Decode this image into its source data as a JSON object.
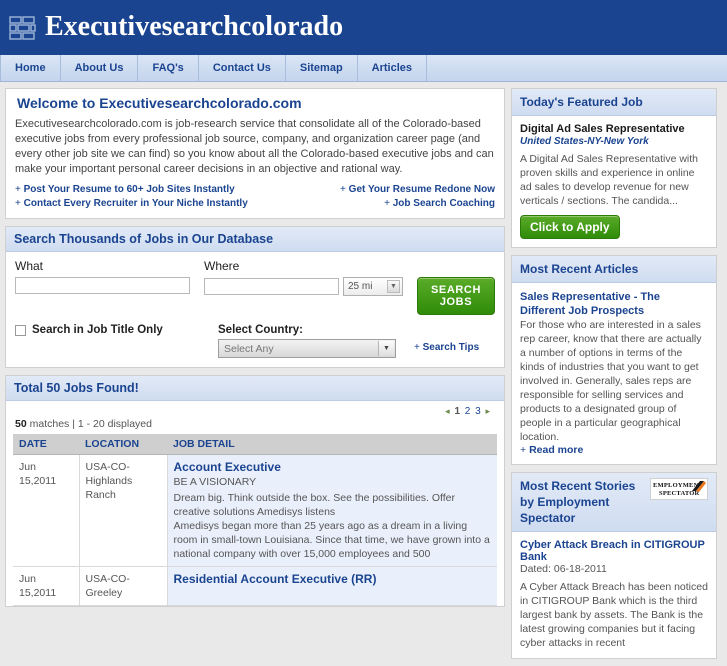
{
  "header": {
    "site_title": "Executivesearchcolorado",
    "logo_icon": "brick-blocks-icon",
    "brand_color": "#1b4490"
  },
  "nav": {
    "items": [
      {
        "label": "Home"
      },
      {
        "label": "About Us"
      },
      {
        "label": "FAQ's"
      },
      {
        "label": "Contact Us"
      },
      {
        "label": "Sitemap"
      },
      {
        "label": "Articles"
      }
    ]
  },
  "welcome": {
    "title": "Welcome to Executivesearchcolorado.com",
    "body": "Executivesearchcolorado.com is job-research service that consolidate all of the Colorado-based executive jobs from every professional job source, company, and organization career page (and every other job site we can find) so you know about all the Colorado-based executive jobs and can make your important personal career decisions in an objective and rational way.",
    "links_left": [
      "Post Your Resume to 60+ Job Sites Instantly",
      "Contact Every Recruiter in Your Niche Instantly"
    ],
    "links_right": [
      "Get Your Resume Redone Now",
      "Job Search Coaching"
    ]
  },
  "search": {
    "panel_title": "Search Thousands of Jobs in Our Database",
    "what_label": "What",
    "what_value": "",
    "what_placeholder": "",
    "where_label": "Where",
    "where_value": "",
    "where_placeholder": "",
    "radius_value": "25 mi",
    "button_label": "SEARCH JOBS",
    "title_only_label": "Search in Job Title Only",
    "title_only_checked": false,
    "country_label": "Select Country:",
    "country_value": "Select Any",
    "tips_label": "Search Tips",
    "plus": "+"
  },
  "results": {
    "panel_title": "Total 50 Jobs Found!",
    "pager": {
      "prev": "◂",
      "next": "▸",
      "pages": [
        "1",
        "2",
        "3"
      ],
      "current": "1"
    },
    "matches_count": "50",
    "matches_text": "matches | 1 - 20 displayed",
    "columns": [
      "DATE",
      "LOCATION",
      "JOB DETAIL"
    ],
    "rows": [
      {
        "date": "Jun 15,2011",
        "location": "USA-CO-Highlands Ranch",
        "title": "Account Executive",
        "subtitle": "BE A VISIONARY",
        "desc": "Dream big. Think outside the box. See the possibilities. Offer creative solutions Amedisys listens\nAmedisys began more than 25 years ago as a dream in a living room in small-town Louisiana. Since that time, we have grown into a national company with over 15,000 employees and 500"
      },
      {
        "date": "Jun 15,2011",
        "location": "USA-CO-Greeley",
        "title": "Residential Account Executive (RR)",
        "subtitle": "",
        "desc": ""
      }
    ]
  },
  "sidebar": {
    "featured": {
      "title": "Today's Featured Job",
      "job_title": "Digital Ad Sales Representative",
      "job_location": "United States-NY-New York",
      "job_desc": "A Digital Ad Sales Representative with proven skills and experience in online ad sales to develop revenue for new verticals / sections. The candida...",
      "apply_label": "Click to Apply"
    },
    "articles": {
      "title": "Most Recent Articles",
      "article_title": "Sales Representative - The Different Job Prospects",
      "article_text": "For those who are interested in a sales rep career, know that there are actually a number of options in terms of the kinds of industries that you want to get involved in. Generally, sales reps are responsible for selling services and products to a designated group of people in a particular geographical location.",
      "read_more": "Read more",
      "plus": "+"
    },
    "stories": {
      "title": "Most Recent Stories by Employment Spectator",
      "logo_line1": "EMPLOYMENT",
      "logo_line2": "SPECTATOR",
      "logo_icon": "employment-spectator-logo",
      "story_title": "Cyber Attack Breach in CITIGROUP Bank",
      "story_date": "Dated: 06-18-2011",
      "story_text": "A Cyber Attack Breach has been noticed in CITIGROUP Bank which is the third largest bank by assets. The Bank is the latest growing companies but it facing cyber attacks in recent"
    }
  }
}
